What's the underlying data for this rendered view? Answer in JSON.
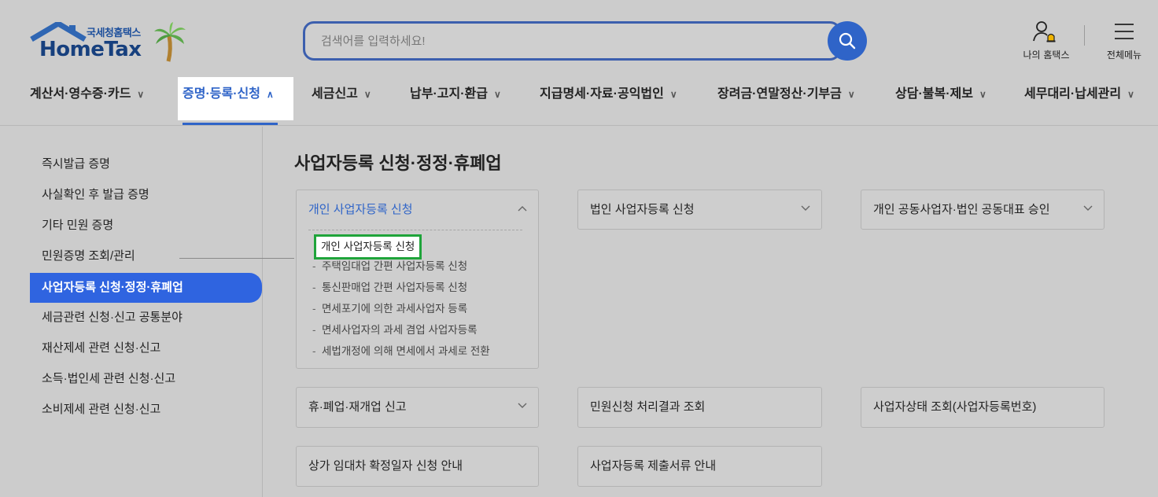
{
  "header": {
    "logo_sub": "국세청홈택스",
    "logo_main": "HomeTax",
    "search_placeholder": "검색어를 입력하세요!",
    "my_hometax": "나의 홈택스",
    "all_menu": "전체메뉴"
  },
  "gnb": [
    {
      "label": "계산서·영수증·카드"
    },
    {
      "label": "증명·등록·신청"
    },
    {
      "label": "세금신고"
    },
    {
      "label": "납부·고지·환급"
    },
    {
      "label": "지급명세·자료·공익법인"
    },
    {
      "label": "장려금·연말정산·기부금"
    },
    {
      "label": "상담·불복·제보"
    },
    {
      "label": "세무대리·납세관리"
    }
  ],
  "sidebar": [
    {
      "label": "즉시발급 증명"
    },
    {
      "label": "사실확인 후 발급 증명"
    },
    {
      "label": "기타 민원 증명"
    },
    {
      "label": "민원증명 조회/관리"
    },
    {
      "label": "사업자등록 신청·정정·휴폐업"
    },
    {
      "label": "세금관련 신청·신고 공통분야"
    },
    {
      "label": "재산제세 관련 신청·신고"
    },
    {
      "label": "소득·법인세 관련 신청·신고"
    },
    {
      "label": "소비제세 관련 신청·신고"
    }
  ],
  "main": {
    "title": "사업자등록 신청·정정·휴폐업",
    "cards": [
      {
        "label": "개인 사업자등록 신청"
      },
      {
        "label": "법인 사업자등록 신청"
      },
      {
        "label": "개인 공동사업자·법인 공동대표 승인"
      },
      {
        "label": "휴·폐업·재개업 신고"
      },
      {
        "label": "민원신청 처리결과 조회"
      },
      {
        "label": "사업자상태 조회(사업자등록번호)"
      },
      {
        "label": "상가 임대차 확정일자 신청 안내"
      },
      {
        "label": "사업자등록 제출서류 안내"
      }
    ],
    "submenu": [
      {
        "label": "개인 사업자등록 신청"
      },
      {
        "label": "주택임대업 간편 사업자등록 신청"
      },
      {
        "label": "통신판매업 간편 사업자등록 신청"
      },
      {
        "label": "면세포기에 의한 과세사업자 등록"
      },
      {
        "label": "면세사업자의 과세 겸업 사업자등록"
      },
      {
        "label": "세법개정에 의해 면세에서 과세로 전환"
      }
    ],
    "dash": "-"
  },
  "colors": {
    "accent": "#2f64c8",
    "sidebar_active": "#2f64e0",
    "highlight_border": "#1fa43a",
    "logo_blue": "#17407e"
  }
}
